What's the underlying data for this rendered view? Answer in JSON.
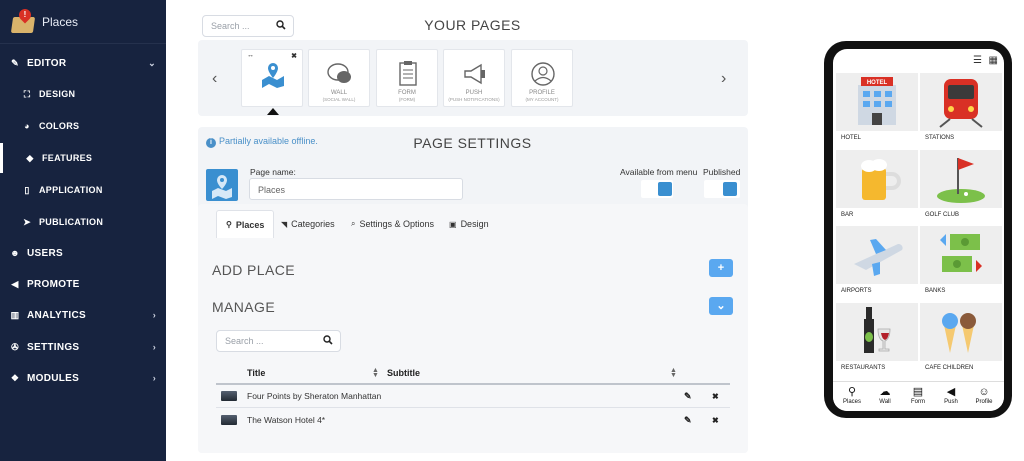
{
  "app": {
    "title": "Places"
  },
  "sidebar": {
    "items": [
      {
        "label": "EDITOR",
        "icon": "pencil-icon",
        "glyph": "✎",
        "level": "top",
        "chevron": "⌄"
      },
      {
        "label": "DESIGN",
        "icon": "design-icon",
        "glyph": "⛶",
        "level": "sub"
      },
      {
        "label": "COLORS",
        "icon": "palette-icon",
        "glyph": "◕",
        "level": "sub"
      },
      {
        "label": "FEATURES",
        "icon": "cube-icon",
        "glyph": "◆",
        "level": "sub",
        "active": true
      },
      {
        "label": "APPLICATION",
        "icon": "mobile-icon",
        "glyph": "▯",
        "level": "sub"
      },
      {
        "label": "PUBLICATION",
        "icon": "send-icon",
        "glyph": "➤",
        "level": "sub"
      },
      {
        "label": "USERS",
        "icon": "users-icon",
        "glyph": "☻",
        "level": "top"
      },
      {
        "label": "PROMOTE",
        "icon": "bullhorn-icon",
        "glyph": "◀",
        "level": "top"
      },
      {
        "label": "ANALYTICS",
        "icon": "bar-chart-icon",
        "glyph": "▥",
        "level": "top",
        "chevron": "›"
      },
      {
        "label": "SETTINGS",
        "icon": "wrench-icon",
        "glyph": "✇",
        "level": "top",
        "chevron": "›"
      },
      {
        "label": "MODULES",
        "icon": "cubes-icon",
        "glyph": "❖",
        "level": "top",
        "chevron": "›"
      }
    ]
  },
  "pages": {
    "search_placeholder": "Search ...",
    "title": "YOUR PAGES",
    "cards": [
      {
        "label": "",
        "sub": "",
        "icon": "places-icon",
        "selected": true
      },
      {
        "label": "WALL",
        "sub": "(SOCIAL WALL)",
        "icon": "wall-icon"
      },
      {
        "label": "FORM",
        "sub": "(FORM)",
        "icon": "form-icon"
      },
      {
        "label": "PUSH",
        "sub": "(PUSH NOTIFICATIONS)",
        "icon": "push-icon"
      },
      {
        "label": "PROFILE",
        "sub": "(MY ACCOUNT)",
        "icon": "profile-icon"
      }
    ],
    "prev": "‹",
    "next": "›"
  },
  "settings": {
    "offline_notice": "Partially available offline.",
    "title": "PAGE SETTINGS",
    "page_name_label": "Page name:",
    "page_name_value": "Places",
    "available_label": "Available from menu",
    "published_label": "Published"
  },
  "tabs": [
    {
      "label": "Places",
      "icon": "map-marker-icon",
      "glyph": "⚲",
      "active": true
    },
    {
      "label": "Categories",
      "icon": "tags-icon",
      "glyph": "◥"
    },
    {
      "label": "Settings & Options",
      "icon": "search-icon",
      "glyph": "⌕"
    },
    {
      "label": "Design",
      "icon": "image-icon",
      "glyph": "▣"
    }
  ],
  "places": {
    "add_title": "ADD PLACE",
    "add_button": "+",
    "manage_title": "MANAGE",
    "manage_button": "⌄",
    "search_placeholder": "Search ...",
    "columns": [
      "Title",
      "Subtitle"
    ],
    "rows": [
      {
        "title": "Four Points by Sheraton Manhattan",
        "subtitle": ""
      },
      {
        "title": "The Watson Hotel 4*",
        "subtitle": ""
      }
    ],
    "edit_glyph": "✎",
    "delete_glyph": "✖"
  },
  "phone": {
    "tiles": [
      {
        "label": "HOTEL",
        "sign": "HOTEL"
      },
      {
        "label": "STATIONS"
      },
      {
        "label": "BAR"
      },
      {
        "label": "GOLF CLUB"
      },
      {
        "label": "AIRPORTS"
      },
      {
        "label": "BANKS"
      },
      {
        "label": "RESTAURANTS"
      },
      {
        "label": "CAFE CHILDREN"
      }
    ],
    "nav": [
      {
        "label": "Places",
        "glyph": "⚲"
      },
      {
        "label": "Wall",
        "glyph": "☁"
      },
      {
        "label": "Form",
        "glyph": "▤"
      },
      {
        "label": "Push",
        "glyph": "◀"
      },
      {
        "label": "Profile",
        "glyph": "☺"
      }
    ],
    "list_glyph": "☰",
    "map_glyph": "▦"
  },
  "colors": {
    "sidebar_bg": "#17233f",
    "accent": "#3a8fd0",
    "button_blue": "#5aa8f0"
  }
}
